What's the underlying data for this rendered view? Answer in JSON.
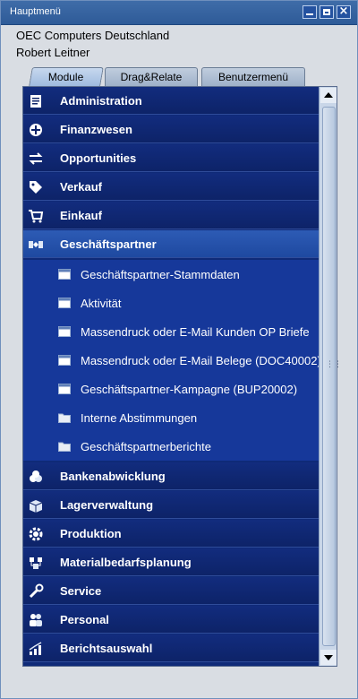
{
  "window": {
    "title": "Hauptmenü"
  },
  "header": {
    "company": "OEC Computers Deutschland",
    "user": "Robert Leitner"
  },
  "tabs": [
    {
      "label": "Module",
      "selected": true
    },
    {
      "label": "Drag&Relate",
      "selected": false
    },
    {
      "label": "Benutzermenü",
      "selected": false
    }
  ],
  "menu": {
    "top_items": [
      {
        "label": "Administration",
        "icon": "administration-icon"
      },
      {
        "label": "Finanzwesen",
        "icon": "finance-icon"
      },
      {
        "label": "Opportunities",
        "icon": "opportunities-icon"
      },
      {
        "label": "Verkauf",
        "icon": "sales-tag-icon"
      },
      {
        "label": "Einkauf",
        "icon": "shopping-cart-icon"
      },
      {
        "label": "Geschäftspartner",
        "icon": "business-partner-icon",
        "expanded": true
      }
    ],
    "sub_items": [
      {
        "label": "Geschäftspartner-Stammdaten",
        "icon": "form-window-icon"
      },
      {
        "label": "Aktivität",
        "icon": "form-window-icon"
      },
      {
        "label": "Massendruck oder E-Mail Kunden OP Briefe",
        "icon": "form-window-icon"
      },
      {
        "label": "Massendruck oder E-Mail Belege (DOC40002)",
        "icon": "form-window-icon"
      },
      {
        "label": "Geschäftspartner-Kampagne (BUP20002)",
        "icon": "form-window-icon"
      },
      {
        "label": "Interne Abstimmungen",
        "icon": "folder-icon"
      },
      {
        "label": "Geschäftspartnerberichte",
        "icon": "folder-icon"
      }
    ],
    "bottom_items": [
      {
        "label": "Bankenabwicklung",
        "icon": "banking-icon"
      },
      {
        "label": "Lagerverwaltung",
        "icon": "inventory-icon"
      },
      {
        "label": "Produktion",
        "icon": "production-gear-icon"
      },
      {
        "label": "Materialbedarfsplanung",
        "icon": "mrp-icon"
      },
      {
        "label": "Service",
        "icon": "service-wrench-icon"
      },
      {
        "label": "Personal",
        "icon": "personnel-icon"
      },
      {
        "label": "Berichtsauswahl",
        "icon": "reports-chart-icon"
      }
    ]
  },
  "colors": {
    "menu_bg": "#0f2a78",
    "active_item": "#2d5bb5",
    "sub_bg": "#16389a"
  }
}
